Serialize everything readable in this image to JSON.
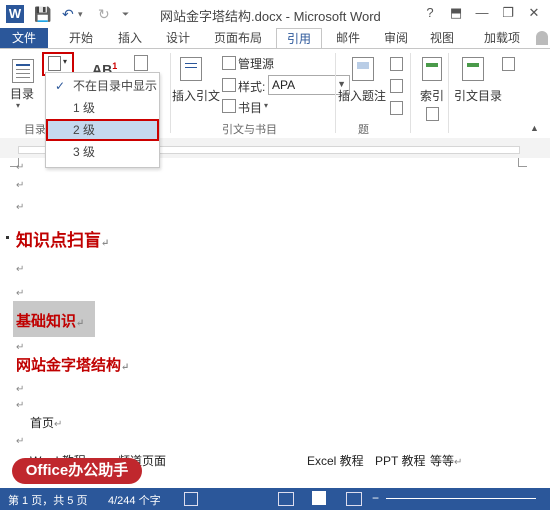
{
  "window": {
    "title": "网站金字塔结构.docx - Microsoft Word",
    "help": "?",
    "min": "—",
    "restore": "❐",
    "close": "✕"
  },
  "qat": {
    "save": "💾",
    "undo": "↶",
    "redo": "↻"
  },
  "tabs": [
    "文件",
    "开始",
    "插入",
    "设计",
    "页面布局",
    "引用",
    "邮件",
    "审阅",
    "视图",
    "加载项"
  ],
  "ribbon": {
    "toc_label": "目录",
    "toc_group_label": "目录",
    "insert_citation": "插入引文",
    "manage_sources": "管理源",
    "style_label": "样式:",
    "style_value": "APA",
    "bibliography": "书目",
    "group_citations": "引文与书目",
    "insert_caption": "插入题注",
    "group_captions": "题",
    "index": "索引",
    "toa": "引文目录"
  },
  "dropdown": {
    "items": [
      "不在目录中显示",
      "1 级",
      "2 级",
      "3 级"
    ]
  },
  "doc": {
    "para_mark": "↵",
    "h1": "知识点扫盲",
    "h2_basic": "基础知识",
    "h2_site": "网站金字塔结构",
    "homepage": "首页",
    "line_word": "Word 教程",
    "line_channel": "频道页面",
    "line_excel": "Excel 教程",
    "line_ppt": "PPT 教程",
    "line_etc": "等等"
  },
  "status": {
    "page": "第 1 页，共 5 页",
    "words": "4/244 个字"
  },
  "badge": "Office办公助手"
}
